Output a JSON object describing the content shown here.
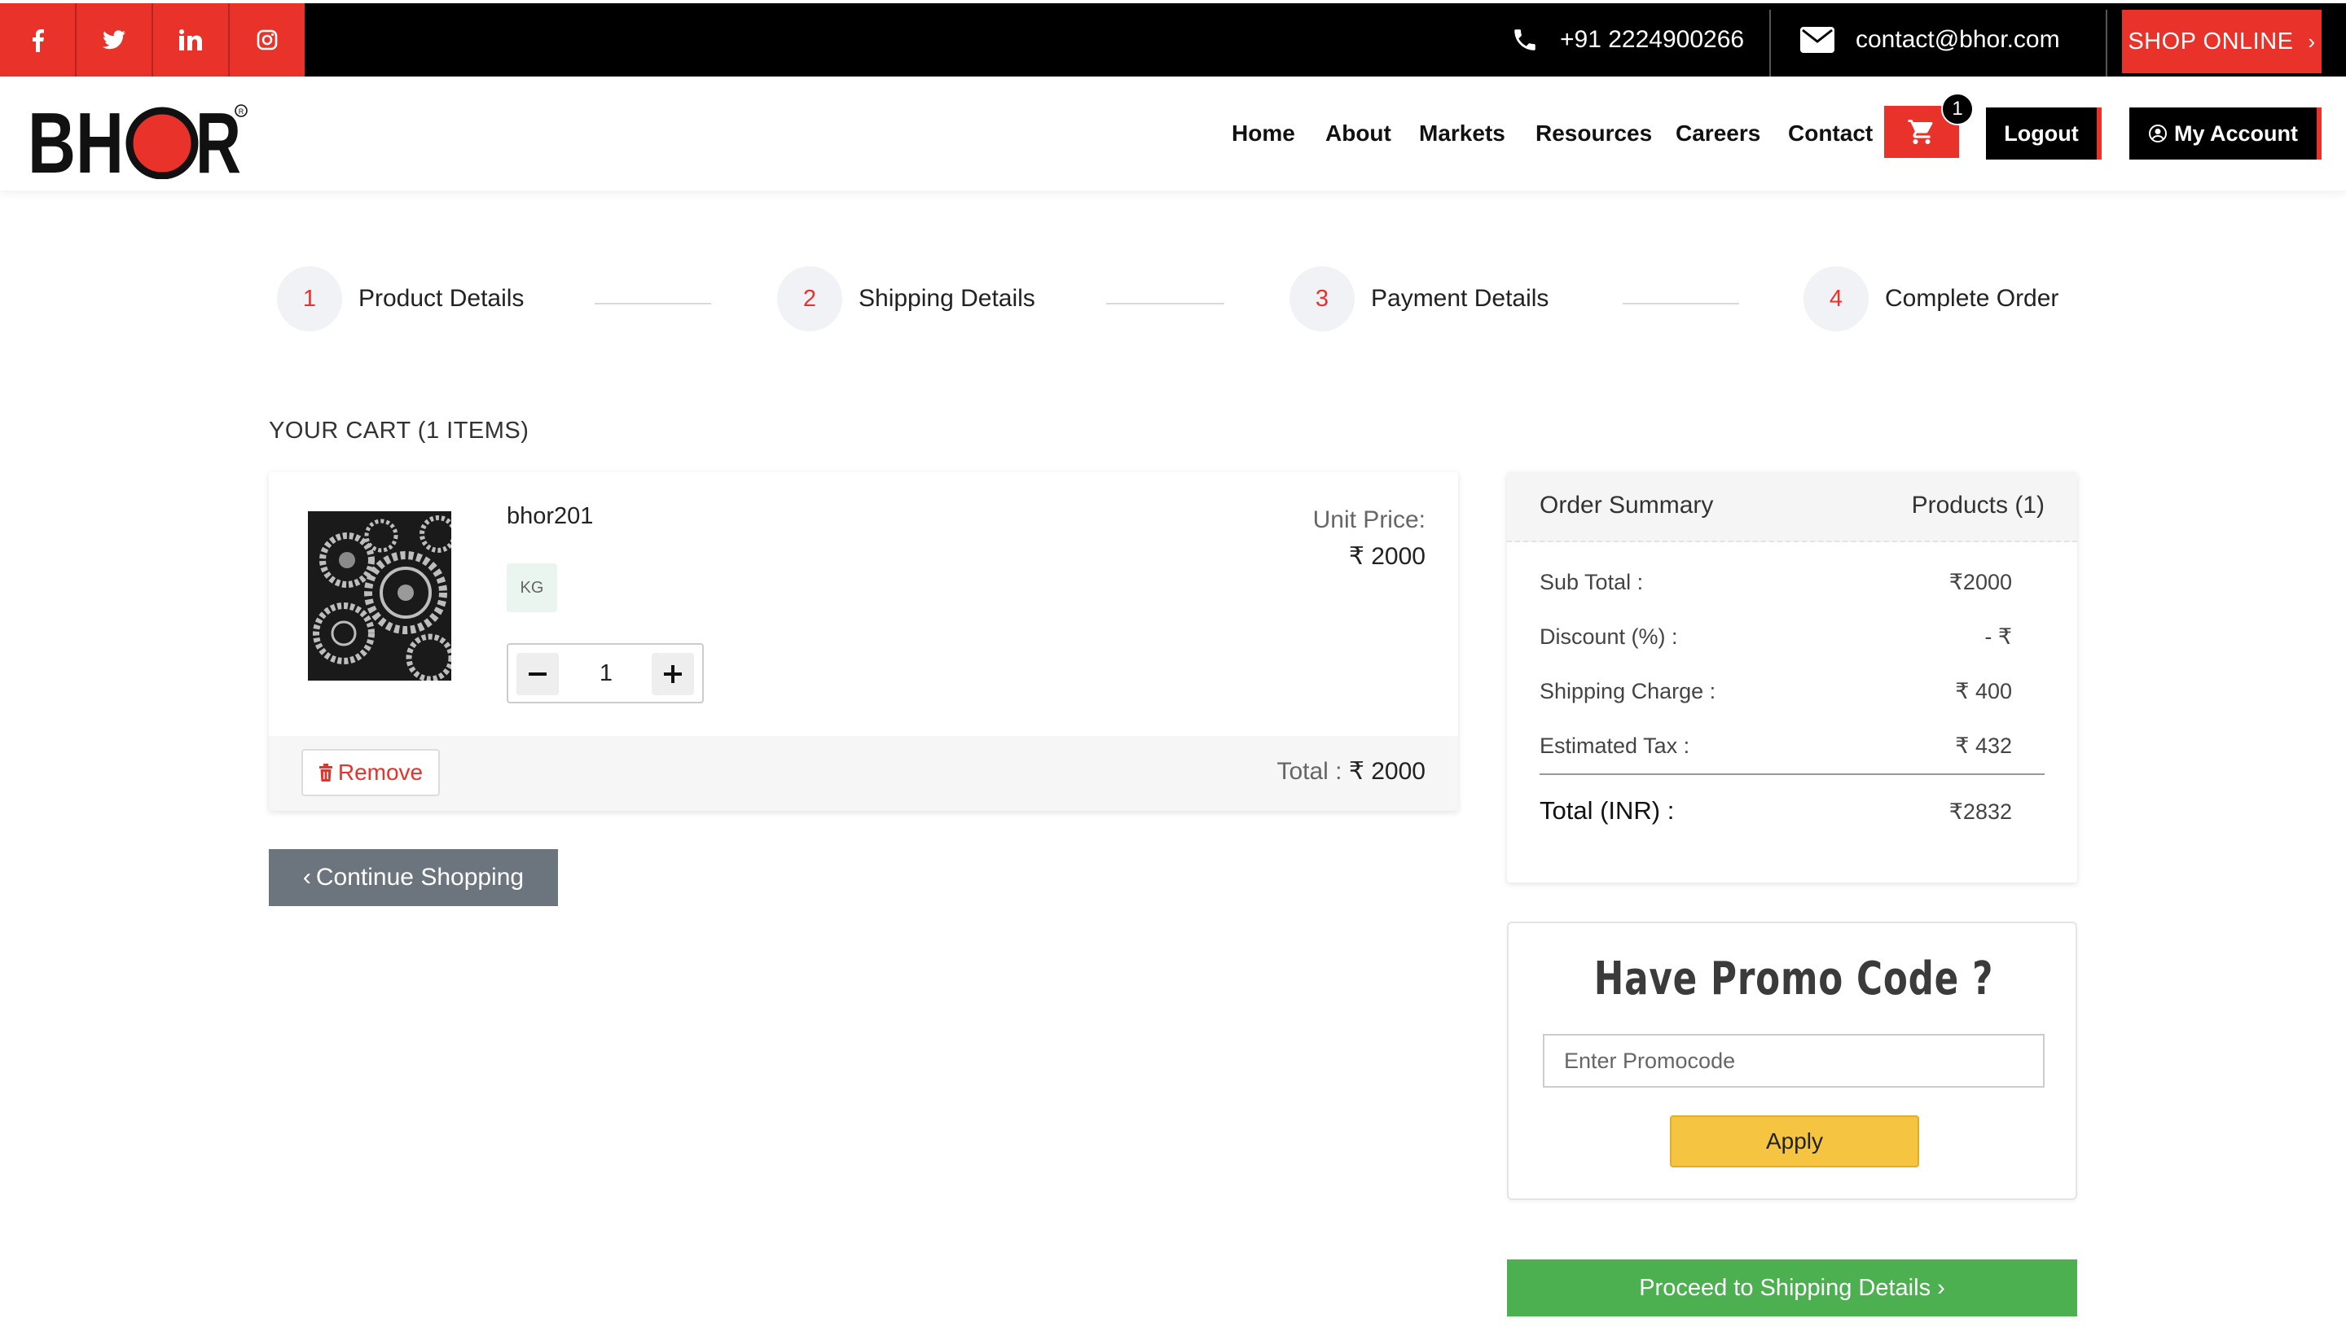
{
  "topbar": {
    "social": [
      "facebook-icon",
      "twitter-icon",
      "linkedin-icon",
      "instagram-icon"
    ],
    "social_glyphs": [
      "f",
      "→",
      "in",
      "◎"
    ],
    "phone": "+91 2224900266",
    "email": "contact@bhor.com",
    "shop_online": "SHOP ONLINE",
    "shop_chevron": "›"
  },
  "header": {
    "logo_text": "BHOR",
    "nav": [
      "Home",
      "About",
      "Markets",
      "Resources",
      "Careers",
      "Contact"
    ],
    "cart_count": "1",
    "logout": "Logout",
    "my_account": "My Account"
  },
  "steps": [
    {
      "num": "1",
      "label": "Product Details"
    },
    {
      "num": "2",
      "label": "Shipping Details"
    },
    {
      "num": "3",
      "label": "Payment Details"
    },
    {
      "num": "4",
      "label": "Complete Order"
    }
  ],
  "cart": {
    "title": "YOUR CART (1 ITEMS)",
    "item": {
      "name": "bhor201",
      "unit": "KG",
      "quantity": "1",
      "unit_price_label": "Unit Price:",
      "unit_price": "₹ 2000",
      "remove": "Remove",
      "total_label": "Total : ",
      "total": "₹ 2000"
    },
    "continue": "Continue Shopping",
    "continue_chevron": "‹"
  },
  "summary": {
    "title": "Order Summary",
    "products": "Products (1)",
    "rows": [
      {
        "label": "Sub Total :",
        "value": "₹2000"
      },
      {
        "label": "Discount (%) :",
        "value": "- ₹"
      },
      {
        "label": "Shipping Charge :",
        "value": "₹ 400"
      },
      {
        "label": "Estimated Tax :",
        "value": "₹ 432"
      }
    ],
    "total_label": "Total (INR) :",
    "total_value": "₹2832"
  },
  "promo": {
    "title": "Have Promo Code ?",
    "placeholder": "Enter Promocode",
    "apply": "Apply"
  },
  "proceed": "Proceed to Shipping Details ›",
  "colors": {
    "accent": "#e8322a",
    "success": "#4caf50",
    "apply": "#f5c542",
    "secondary": "#6c757d"
  }
}
